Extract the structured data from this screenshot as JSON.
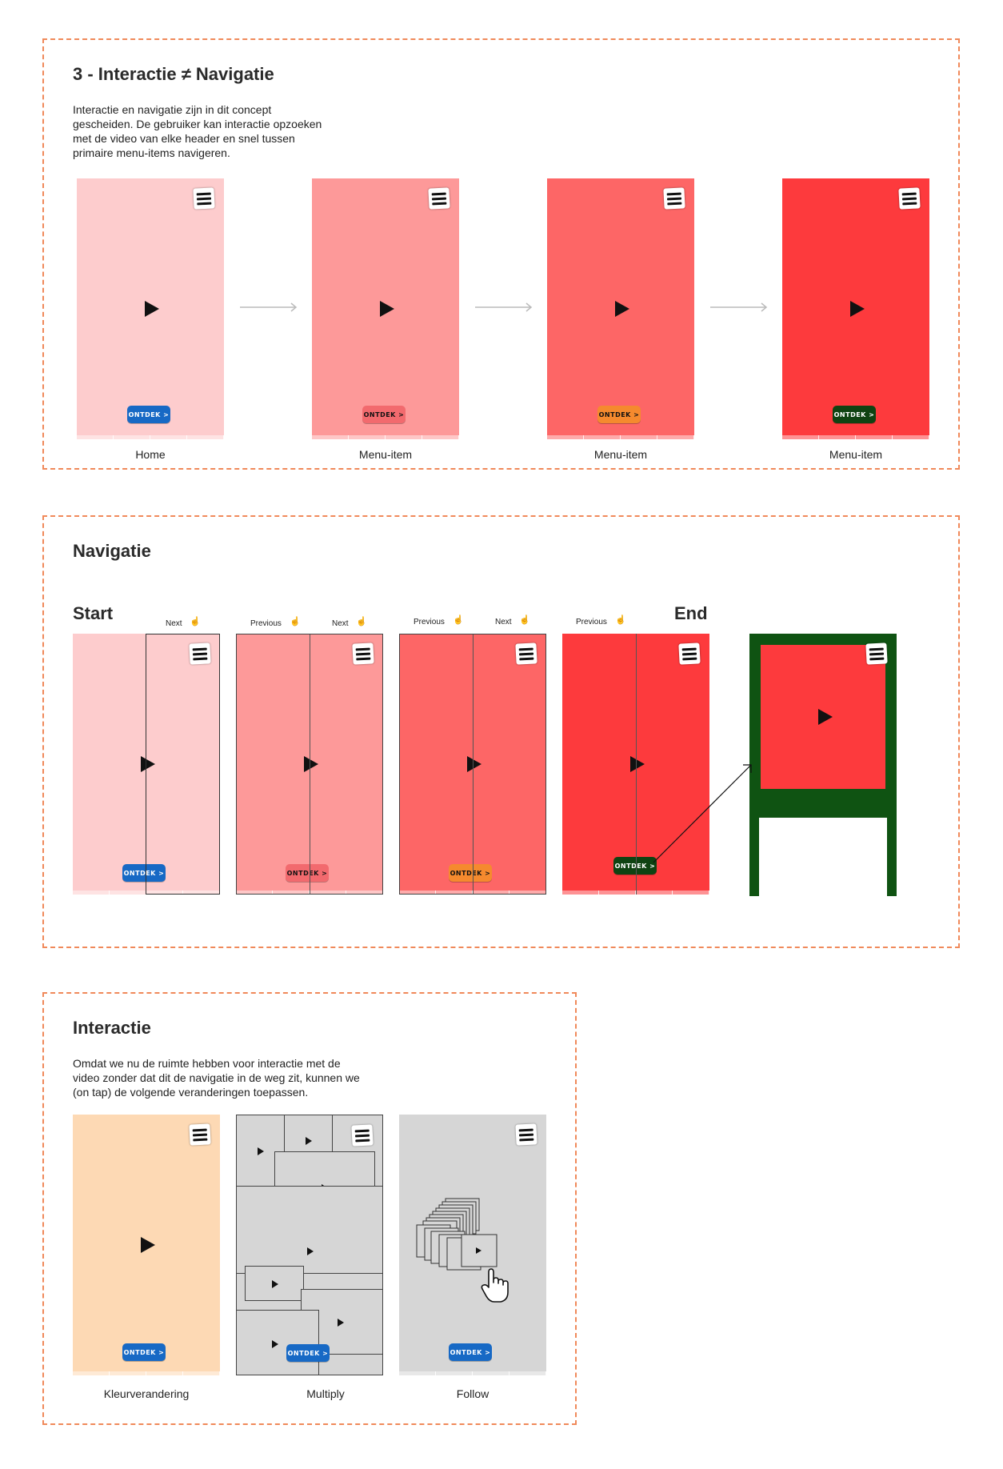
{
  "section1": {
    "title": "3 - Interactie ≠ Navigatie",
    "description": "Interactie en navigatie zijn in dit concept\ngescheiden. De gebruiker kan interactie opzoeken\nmet de video van elke header en snel tussen\nprimaire menu-items navigeren.",
    "screens": [
      {
        "caption": "Home",
        "bg": "#fdcccd",
        "cta": "ONTDEK >",
        "cta_color": "#1769c5"
      },
      {
        "caption": "Menu-item",
        "bg": "#fd9999",
        "cta": "ONTDEK >",
        "cta_color": "#f26a6e"
      },
      {
        "caption": "Menu-item",
        "bg": "#fd6666",
        "cta": "ONTDEK >",
        "cta_color": "#f58a2e"
      },
      {
        "caption": "Menu-item",
        "bg": "#fd3a3d",
        "cta": "ONTDEK >",
        "cta_color": "#0f4312"
      }
    ]
  },
  "section2": {
    "title": "Navigatie",
    "start_label": "Start",
    "end_label": "End",
    "labels": {
      "next": "Next",
      "previous": "Previous"
    },
    "screens": [
      {
        "bg": "#fdcccd",
        "cta": "ONTDEK >",
        "cta_color": "#1769c5"
      },
      {
        "bg": "#fd9999",
        "cta": "ONTDEK >",
        "cta_color": "#f26a6e"
      },
      {
        "bg": "#fd6666",
        "cta": "ONTDEK >",
        "cta_color": "#f58a2e"
      },
      {
        "bg": "#fd3a3d",
        "cta": "ONTDEK >",
        "cta_color": "#0f4312"
      }
    ],
    "end_screen": {
      "frame_color": "#0f5312",
      "video_color": "#fd3a3d"
    }
  },
  "section3": {
    "title": "Interactie",
    "description": "Omdat we nu de ruimte hebben voor interactie met de\nvideo zonder dat dit de navigatie in de weg zit, kunnen we\n(on tap) de volgende veranderingen toepassen.",
    "screens": [
      {
        "caption": "Kleurverandering",
        "bg": "#fdd9b4",
        "cta": "ONTDEK >",
        "cta_color": "#1769c5"
      },
      {
        "caption": "Multiply",
        "bg": "#d6d6d6",
        "cta": "ONTDEK >",
        "cta_color": "#1769c5"
      },
      {
        "caption": "Follow",
        "bg": "#d6d6d6",
        "cta": "ONTDEK >",
        "cta_color": "#1769c5"
      }
    ]
  },
  "colors": {
    "section_border": "#f0895a",
    "arrow": "#bbbbbb"
  },
  "icons": {
    "menu": "hamburger-menu-icon",
    "play": "play-icon",
    "hand": "pointer-hand-icon",
    "arrow": "arrow-right-icon"
  }
}
